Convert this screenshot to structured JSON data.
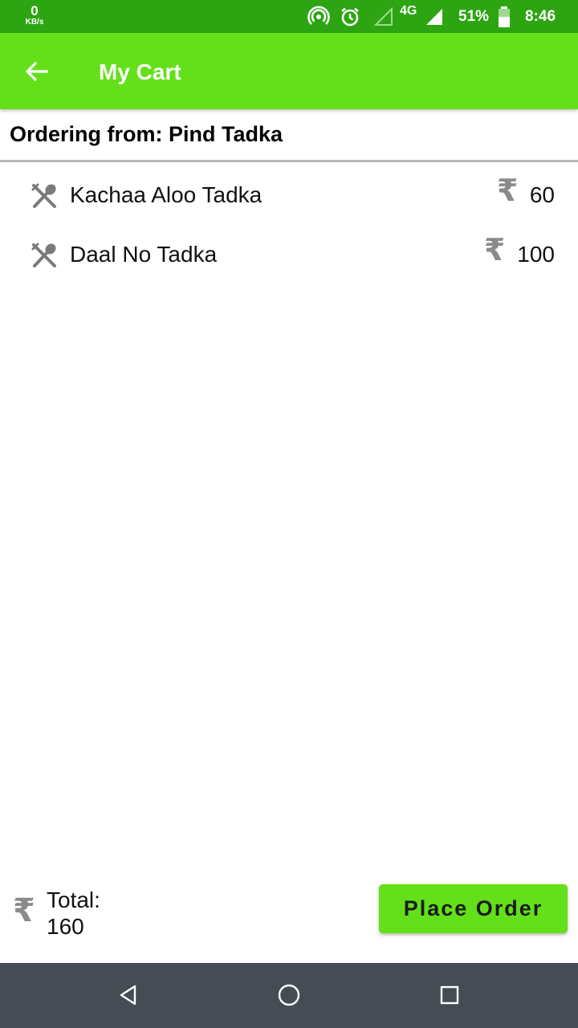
{
  "status_bar": {
    "net_speed": "0",
    "net_unit": "KB/s",
    "network": "4G",
    "battery": "51%",
    "time": "8:46",
    "icons": [
      "hotspot-icon",
      "alarm-icon",
      "signal-empty-icon",
      "signal-icon",
      "battery-icon"
    ]
  },
  "app_bar": {
    "title": "My Cart",
    "back_icon": "arrow-left-icon"
  },
  "ordering": {
    "text": "Ordering from: Pind Tadka"
  },
  "cart": {
    "currency_symbol": "₹",
    "items": [
      {
        "name": "Kachaa Aloo Tadka",
        "price": "60",
        "icon": "fork-spoon-icon"
      },
      {
        "name": "Daal No Tadka",
        "price": "100",
        "icon": "fork-spoon-icon"
      }
    ]
  },
  "footer": {
    "currency_symbol": "₹",
    "total_label": "Total:",
    "total_value": "160",
    "place_order_label": "Place Order"
  },
  "nav_bar": {
    "icons": [
      "back-triangle-icon",
      "home-circle-icon",
      "recents-square-icon"
    ]
  },
  "colors": {
    "status_bar": "#2da512",
    "accent": "#63e019",
    "nav_bar": "#464c54",
    "icon_grey": "#8a8a8a"
  }
}
